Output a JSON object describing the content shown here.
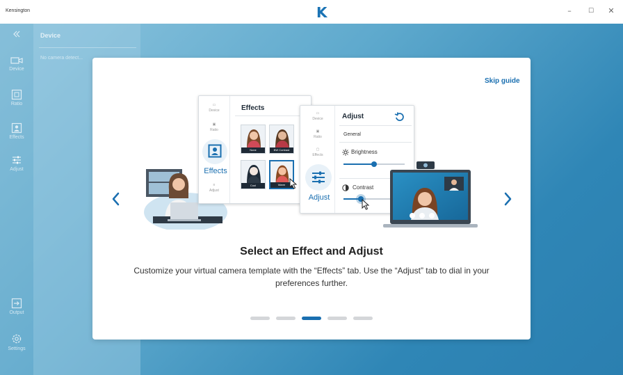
{
  "app": {
    "name": "Kensington",
    "logo": "K"
  },
  "window_controls": {
    "minimize": "–",
    "maximize": "☐",
    "close": "✕"
  },
  "sidebar": {
    "items": [
      {
        "label": "Device",
        "icon": "camera-icon"
      },
      {
        "label": "Ratio",
        "icon": "ratio-icon"
      },
      {
        "label": "Effects",
        "icon": "effects-icon"
      },
      {
        "label": "Adjust",
        "icon": "adjust-icon"
      },
      {
        "label": "Output",
        "icon": "output-icon"
      },
      {
        "label": "Settings",
        "icon": "gear-icon"
      }
    ]
  },
  "panel": {
    "title": "Device",
    "subtitle": "No camera detect..."
  },
  "guide": {
    "skip_label": "Skip guide",
    "heading": "Select an Effect and Adjust",
    "description": "Customize your virtual camera template with the “Effects” tab. Use the “Adjust” tab to dial in your preferences further.",
    "page_count": 5,
    "active_page": 3,
    "illustration": {
      "effects_card": {
        "title": "Effects",
        "nav_label": "Effects",
        "mini_labels": [
          "Device",
          "Ratio",
          "Adjust"
        ],
        "thumbnails": [
          "None",
          "BW Contrast",
          "Cool",
          "Warm"
        ]
      },
      "adjust_card": {
        "title": "Adjust",
        "nav_label": "Adjust",
        "mini_labels": [
          "Device",
          "Ratio",
          "Effects"
        ],
        "section": "General",
        "brightness_label": "Brightness",
        "contrast_label": "Contrast"
      }
    }
  },
  "colors": {
    "accent": "#1a6fb0",
    "background_dim": "#3f92bf"
  }
}
